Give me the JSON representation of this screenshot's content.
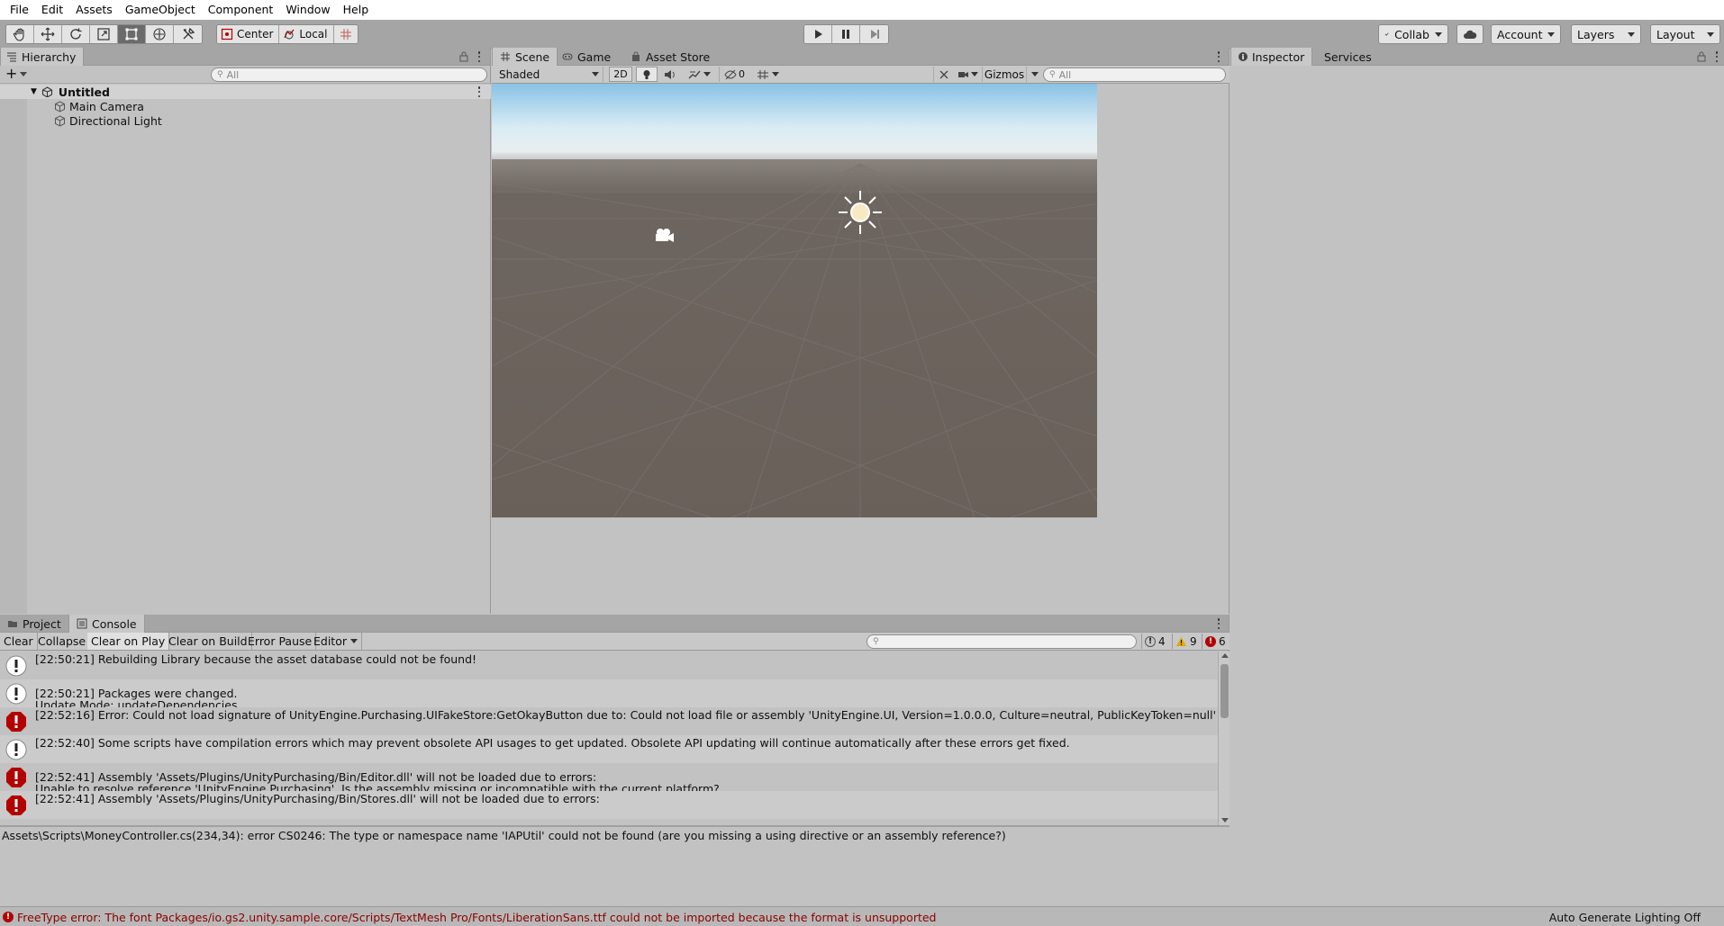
{
  "menu": [
    "File",
    "Edit",
    "Assets",
    "GameObject",
    "Component",
    "Window",
    "Help"
  ],
  "toolbar": {
    "tools": [
      "hand-tool-icon",
      "move-tool-icon",
      "rotate-tool-icon",
      "scale-tool-icon",
      "rect-tool-icon",
      "transform-tool-icon",
      "custom-tool-icon"
    ],
    "active_tool": "rect-tool-icon",
    "pivot_label": "Center",
    "space_label": "Local",
    "collab_label": "Collab",
    "account_label": "Account",
    "layers_label": "Layers",
    "layout_label": "Layout"
  },
  "hierarchy": {
    "tab_label": "Hierarchy",
    "search_placeholder": "All",
    "scene_name": "Untitled",
    "items": [
      "Main Camera",
      "Directional Light"
    ]
  },
  "scene": {
    "tabs": [
      "Scene",
      "Game",
      "Asset Store"
    ],
    "shading_mode": "Shaded",
    "toggle_2d": "2D",
    "hidden_count": "0",
    "gizmos_label": "Gizmos",
    "search_placeholder": "All"
  },
  "inspector": {
    "tabs": [
      "Inspector",
      "Services"
    ]
  },
  "console": {
    "tabs": [
      "Project",
      "Console"
    ],
    "buttons": {
      "clear": "Clear",
      "collapse": "Collapse",
      "clear_on_play": "Clear on Play",
      "clear_on_build": "Clear on Build",
      "error_pause": "Error Pause",
      "editor": "Editor"
    },
    "counts": {
      "info": "4",
      "warning": "9",
      "error": "6"
    },
    "entries": [
      {
        "type": "info",
        "text": "[22:50:21] Rebuilding Library because the asset database could not be found!"
      },
      {
        "type": "info",
        "text": "[22:50:21] Packages were changed.\nUpdate Mode: updateDependencies"
      },
      {
        "type": "error",
        "text": "[22:52:16] Error: Could not load signature of UnityEngine.Purchasing.UIFakeStore:GetOkayButton due to: Could not load file or assembly 'UnityEngine.UI, Version=1.0.0.0, Culture=neutral, PublicKeyToken=null' or one of its dependencies"
      },
      {
        "type": "info",
        "text": "[22:52:40] Some scripts have compilation errors which may prevent obsolete API usages to get updated. Obsolete API updating will continue automatically after these errors get fixed."
      },
      {
        "type": "error",
        "text": "[22:52:41] Assembly 'Assets/Plugins/UnityPurchasing/Bin/Editor.dll' will not be loaded due to errors:\nUnable to resolve reference 'UnityEngine.Purchasing'. Is the assembly missing or incompatible with the current platform?"
      },
      {
        "type": "error",
        "text": "[22:52:41] Assembly 'Assets/Plugins/UnityPurchasing/Bin/Stores.dll' will not be loaded due to errors:"
      }
    ],
    "detail_text": "Assets\\Scripts\\MoneyController.cs(234,34): error CS0246: The type or namespace name 'IAPUtil' could not be found (are you missing a using directive or an assembly reference?)"
  },
  "statusbar": {
    "message": "FreeType error: The font Packages/io.gs2.unity.sample.core/Scripts/TextMesh Pro/Fonts/LiberationSans.ttf could not be imported because the  format is unsupported",
    "right_text": "Auto Generate Lighting Off"
  },
  "colors": {
    "toolbar_bg": "#a5a5a5",
    "panel_bg": "#c2c2c2",
    "error_red": "#b30000",
    "warning_yellow": "#e0a800",
    "status_error_text": "#8b0000"
  }
}
